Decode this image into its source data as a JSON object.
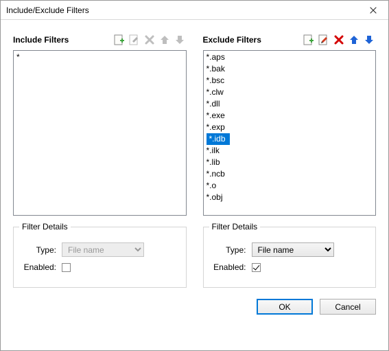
{
  "window": {
    "title": "Include/Exclude Filters"
  },
  "include": {
    "title": "Include Filters",
    "items": [
      "*"
    ],
    "selected_index": -1,
    "toolbar": {
      "add_enabled": true,
      "edit_enabled": false,
      "delete_enabled": false,
      "up_enabled": false,
      "down_enabled": false
    },
    "details": {
      "group_label": "Filter Details",
      "type_label": "Type:",
      "type_value": "File name",
      "type_enabled": false,
      "enabled_label": "Enabled:",
      "enabled_checked": false,
      "enabled_active": false
    }
  },
  "exclude": {
    "title": "Exclude Filters",
    "items": [
      "*.aps",
      "*.bak",
      "*.bsc",
      "*.clw",
      "*.dll",
      "*.exe",
      "*.exp",
      "*.idb",
      "*.ilk",
      "*.lib",
      "*.ncb",
      "*.o",
      "*.obj"
    ],
    "selected_index": 7,
    "toolbar": {
      "add_enabled": true,
      "edit_enabled": true,
      "delete_enabled": true,
      "up_enabled": true,
      "down_enabled": true
    },
    "details": {
      "group_label": "Filter Details",
      "type_label": "Type:",
      "type_value": "File name",
      "type_enabled": true,
      "enabled_label": "Enabled:",
      "enabled_checked": true,
      "enabled_active": true
    }
  },
  "buttons": {
    "ok": "OK",
    "cancel": "Cancel"
  },
  "icons": {
    "add": "add-icon",
    "edit": "edit-icon",
    "delete": "delete-icon",
    "up": "up-icon",
    "down": "down-icon",
    "colors": {
      "green": "#3fa63f",
      "red": "#d40000",
      "blue": "#1e63d6",
      "page": "#f5f5f0",
      "pageborder": "#8a8a8a",
      "gray": "#8a8a8a",
      "pencil": "#c75b1e"
    }
  }
}
